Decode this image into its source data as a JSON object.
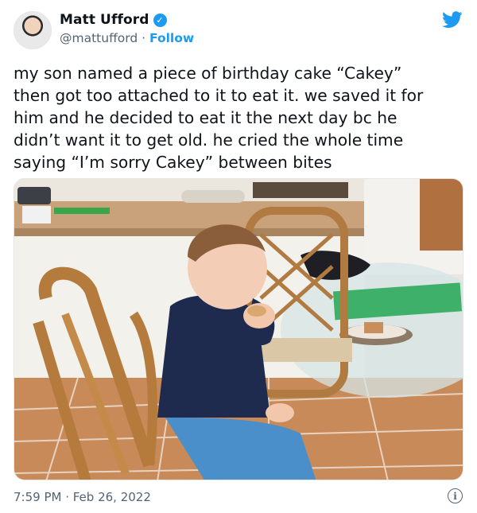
{
  "author": {
    "name": "Matt Ufford",
    "handle": "@mattufford",
    "separator": "·",
    "follow_label": "Follow",
    "verified_glyph": "✓"
  },
  "tweet": {
    "lines": [
      "my son named a piece of birthday cake “Cakey”",
      "then got too attached to it to eat it. we saved it for",
      "him and he decided to eat it the next day bc he",
      "didn’t want it to get old. he cried the whole time",
      "saying “I’m sorry Cakey” between bites"
    ]
  },
  "footer": {
    "timestamp": "7:59 PM · Feb 26, 2022",
    "info_glyph": "i"
  },
  "colors": {
    "accent": "#1d9bf0",
    "text": "#0f1419",
    "muted": "#536471"
  },
  "icons": {
    "brand": "twitter-bird-icon",
    "verified": "verified-badge-icon",
    "info": "info-icon"
  }
}
